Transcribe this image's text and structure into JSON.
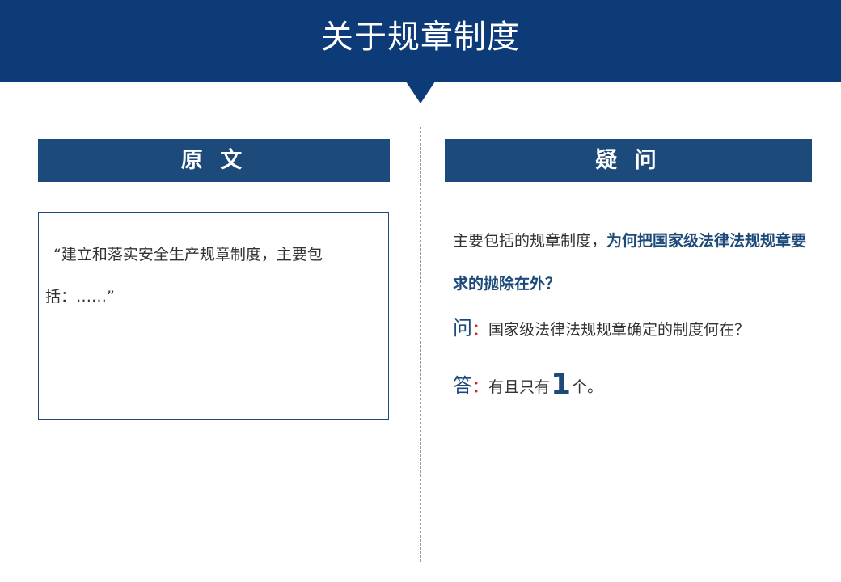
{
  "header": {
    "title": "关于规章制度"
  },
  "left": {
    "header": "原 文",
    "quote": "“建立和落实安全生产规章制度，主要包括：……”"
  },
  "right": {
    "header": "疑 问",
    "question_normal": "主要包括的规章制度，",
    "question_emphasis": "为何把国家级法律法规规章要求的抛除在外？",
    "ask_label": "问",
    "ask_colon": "：",
    "ask_text": "国家级法律法规规章确定的制度何在？",
    "answer_label": "答",
    "answer_colon": "：",
    "answer_prefix": "有且只有",
    "answer_number": "1",
    "answer_suffix": "个。"
  },
  "colors": {
    "banner": "#0d3b78",
    "section_header": "#1c4a7a",
    "emphasis": "#1c4a7a",
    "colon_accent": "#d7201f",
    "divider": "#9a9a9a"
  }
}
